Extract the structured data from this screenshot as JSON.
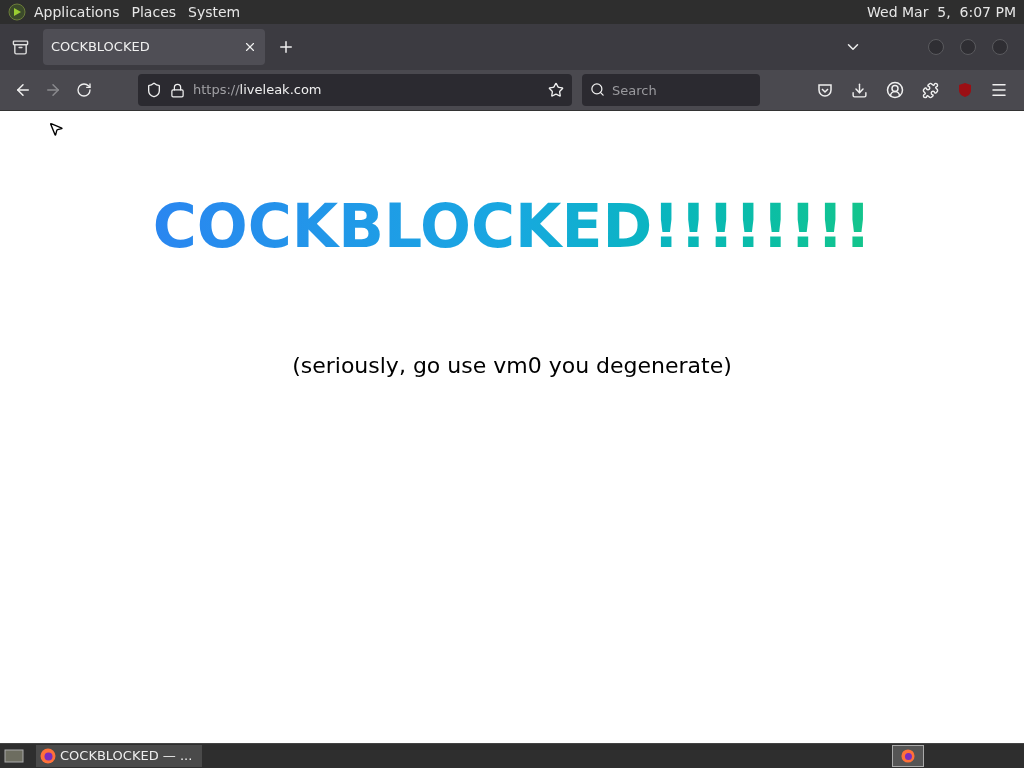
{
  "top_panel": {
    "menus": [
      "Applications",
      "Places",
      "System"
    ],
    "clock": "Wed Mar  5,  6:07 PM"
  },
  "tabs": [
    {
      "title": "COCKBLOCKED",
      "selected": true
    }
  ],
  "toolbar": {
    "url_scheme": "https://",
    "url_host": "liveleak.com",
    "search": {
      "placeholder": "Search"
    }
  },
  "page": {
    "heading": "COCKBLOCKED!!!!!!!!",
    "subtitle": "(seriously, go use vm0 you degenerate)"
  },
  "taskbar": {
    "windows": [
      {
        "title": "COCKBLOCKED — ...",
        "selected": true
      }
    ]
  }
}
